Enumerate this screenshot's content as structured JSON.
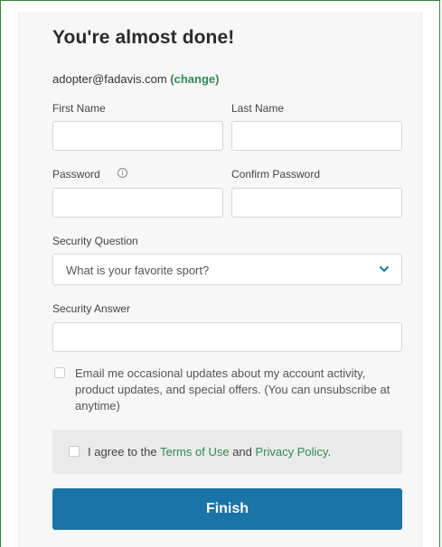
{
  "heading": "You're almost done!",
  "account": {
    "email": "adopter@fadavis.com",
    "change_label": "(change)"
  },
  "fields": {
    "first_name": {
      "label": "First Name",
      "value": ""
    },
    "last_name": {
      "label": "Last Name",
      "value": ""
    },
    "password": {
      "label": "Password",
      "info_glyph": "i",
      "value": ""
    },
    "confirm_password": {
      "label": "Confirm Password",
      "value": ""
    },
    "security_question": {
      "label": "Security Question",
      "selected": "What is your favorite sport?"
    },
    "security_answer": {
      "label": "Security Answer",
      "value": ""
    }
  },
  "updates_checkbox": {
    "checked": false,
    "text": "Email me occasional updates about my account activity, product updates, and special offers. (You can unsubscribe at anytime)"
  },
  "terms": {
    "checked": false,
    "prefix": "I agree to the ",
    "terms_link": "Terms of Use",
    "middle": " and ",
    "privacy_link": "Privacy Policy",
    "suffix": "."
  },
  "finish_label": "Finish",
  "colors": {
    "accent_green": "#2e8b57",
    "button_blue": "#1b74a7",
    "frame_green": "#2e8b3a"
  }
}
